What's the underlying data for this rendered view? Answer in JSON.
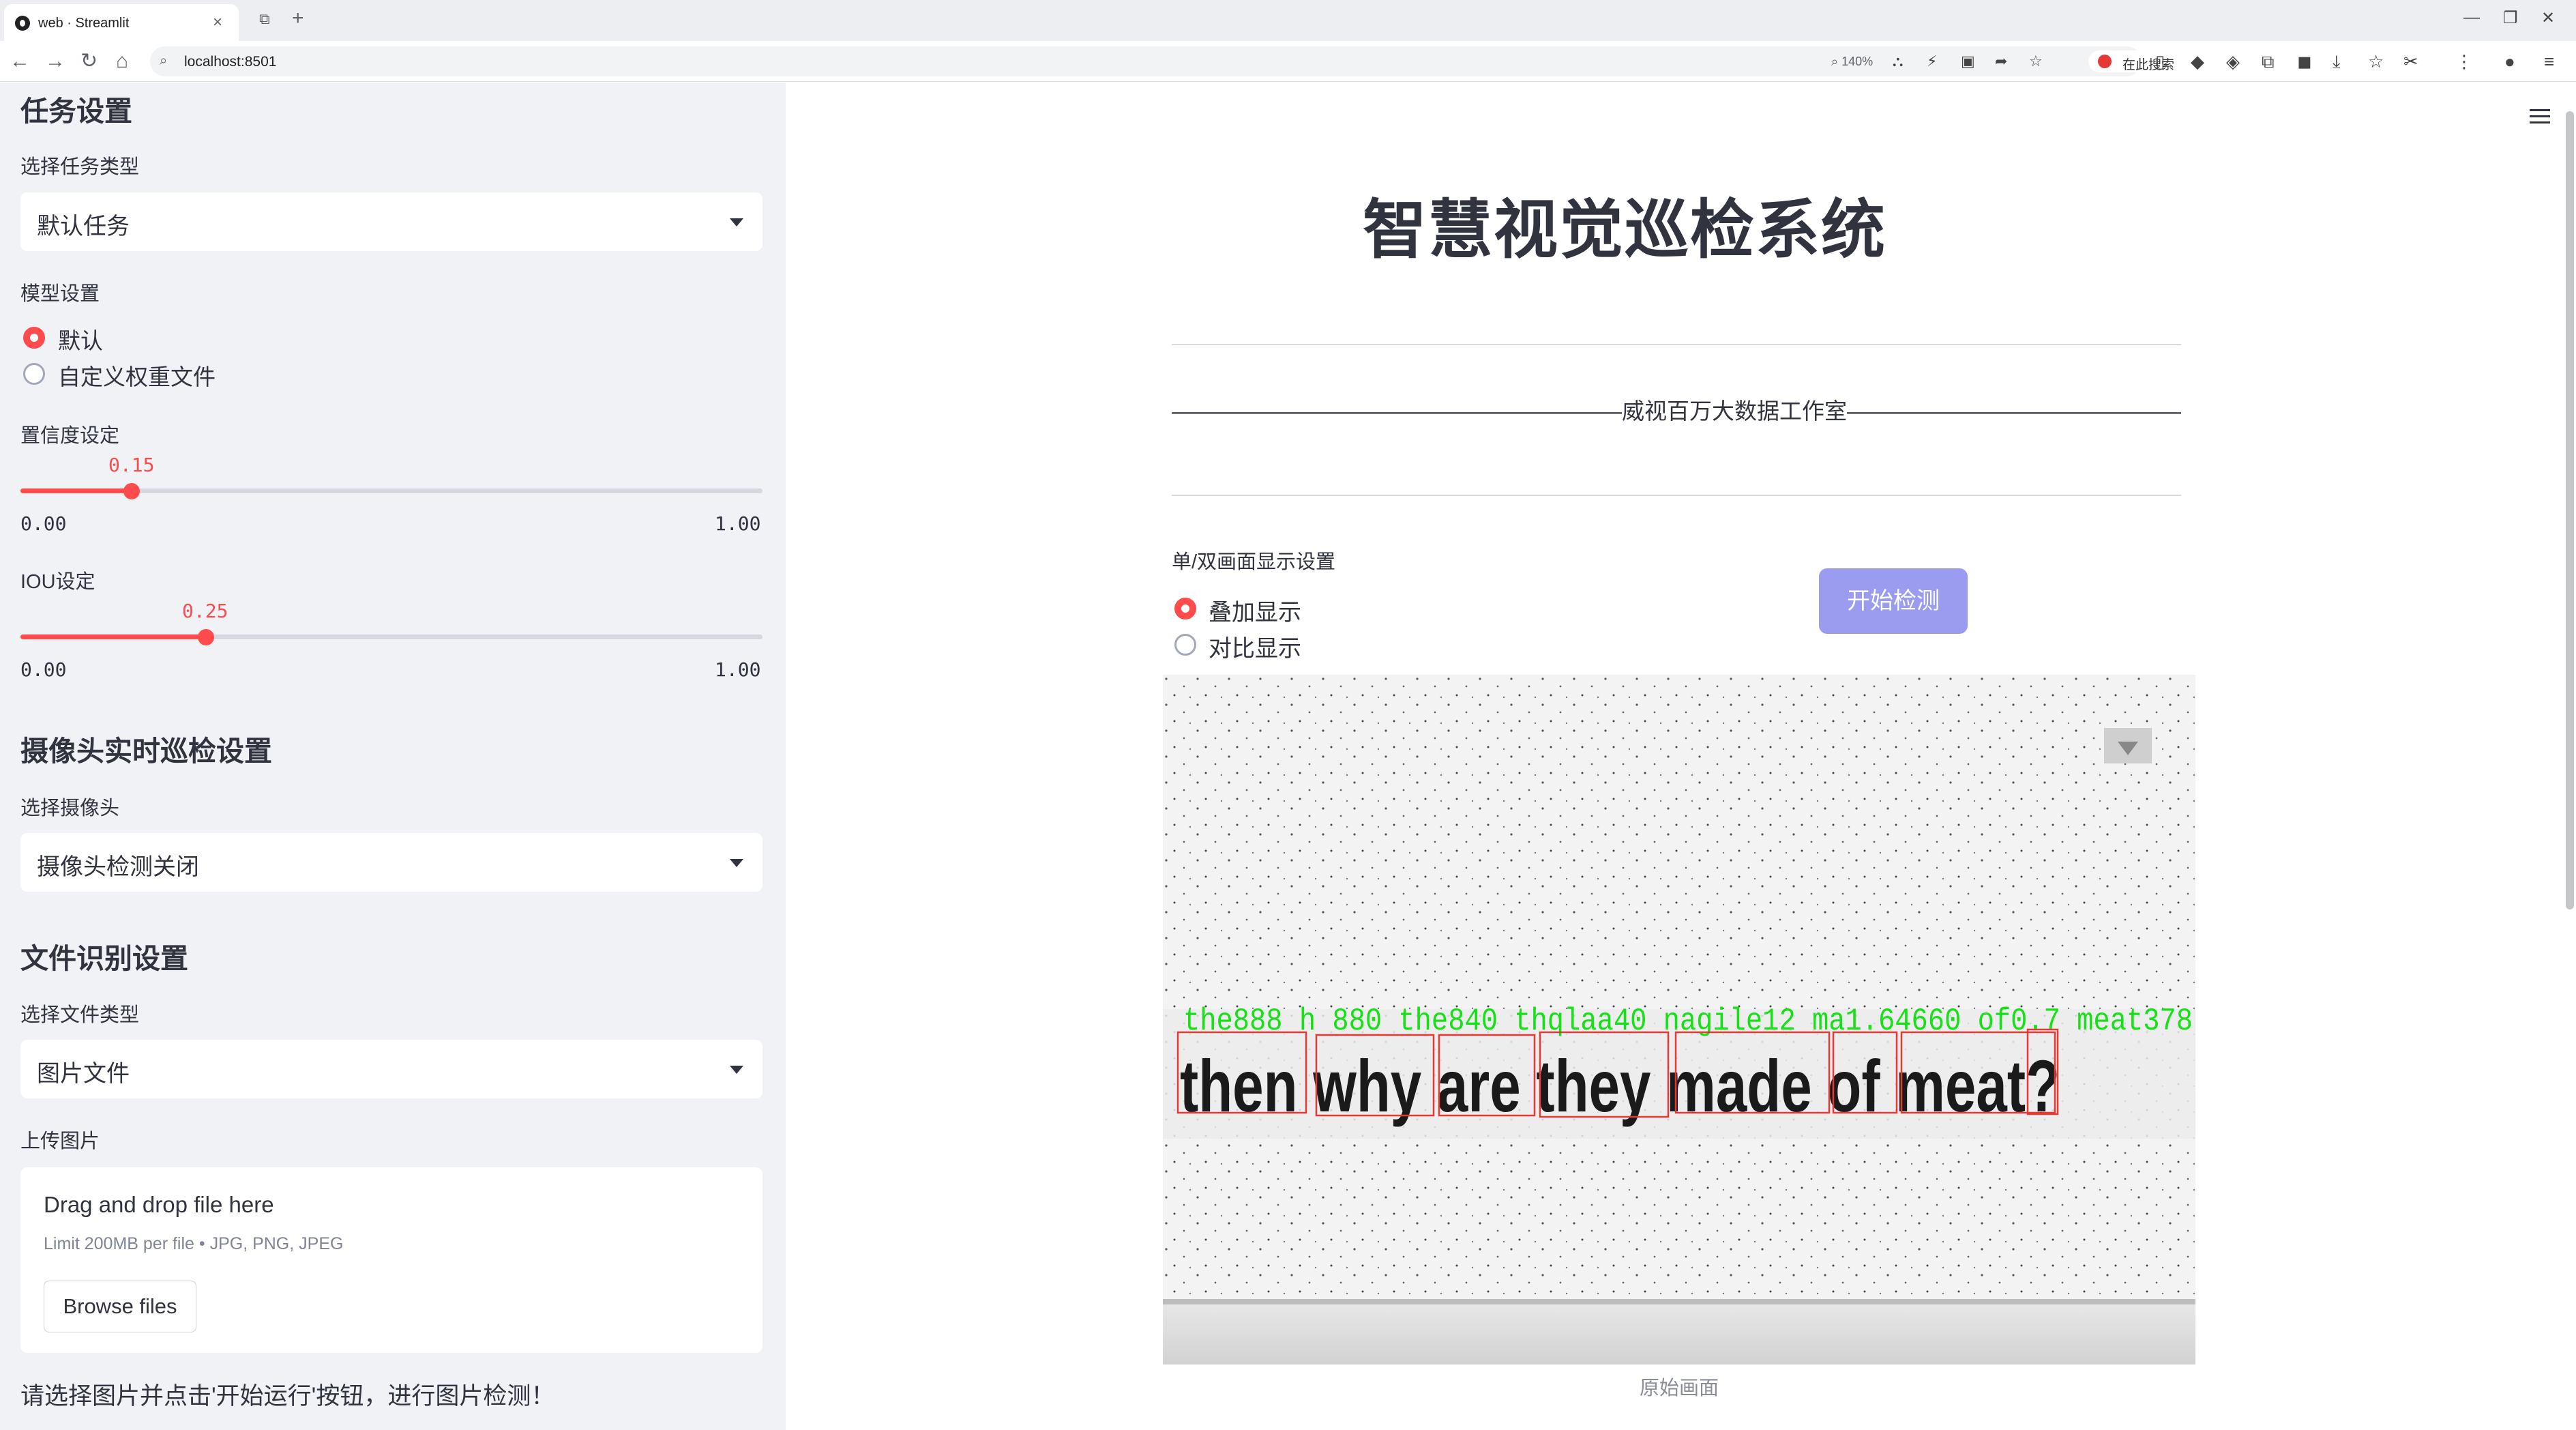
{
  "browser": {
    "tab_title": "web · Streamlit",
    "url": "localhost:8501",
    "zoom": "140%",
    "search_placeholder": "在此搜索"
  },
  "sidebar": {
    "task_section": "任务设置",
    "task_type_label": "选择任务类型",
    "task_type_value": "默认任务",
    "model_label": "模型设置",
    "model_options": [
      "默认",
      "自定义权重文件"
    ],
    "model_selected": "默认",
    "conf_label": "置信度设定",
    "conf_value": "0.15",
    "conf_min": "0.00",
    "conf_max": "1.00",
    "conf_fraction": 0.15,
    "iou_label": "IOU设定",
    "iou_value": "0.25",
    "iou_min": "0.00",
    "iou_max": "1.00",
    "iou_fraction": 0.25,
    "camera_section": "摄像头实时巡检设置",
    "camera_label": "选择摄像头",
    "camera_value": "摄像头检测关闭",
    "file_section": "文件识别设置",
    "file_type_label": "选择文件类型",
    "file_type_value": "图片文件",
    "upload_label": "上传图片",
    "uploader_title": "Drag and drop file here",
    "uploader_limit": "Limit 200MB per file • JPG, PNG, JPEG",
    "browse_button": "Browse files",
    "note": "请选择图片并点击'开始运行'按钮，进行图片检测！"
  },
  "main": {
    "title": "智慧视觉巡检系统",
    "subtitle": "————————————————————威视百万大数据工作室—————————————————————",
    "display_label": "单/双画面显示设置",
    "display_options": [
      "叠加显示",
      "对比显示"
    ],
    "display_selected": "叠加显示",
    "start_button": "开始检测",
    "image_text": "then why are they made of meat?",
    "detections_text": "the888 h 880 the840 thqlaa40 nagile12 ma1.64660 of0.7 meat378",
    "caption": "原始画面"
  },
  "colors": {
    "accent": "#ff4b4b",
    "sidebar_bg": "#f0f2f6",
    "button": "#9b9cf0",
    "detection_box": "#e53935",
    "detection_label": "#16e016"
  }
}
